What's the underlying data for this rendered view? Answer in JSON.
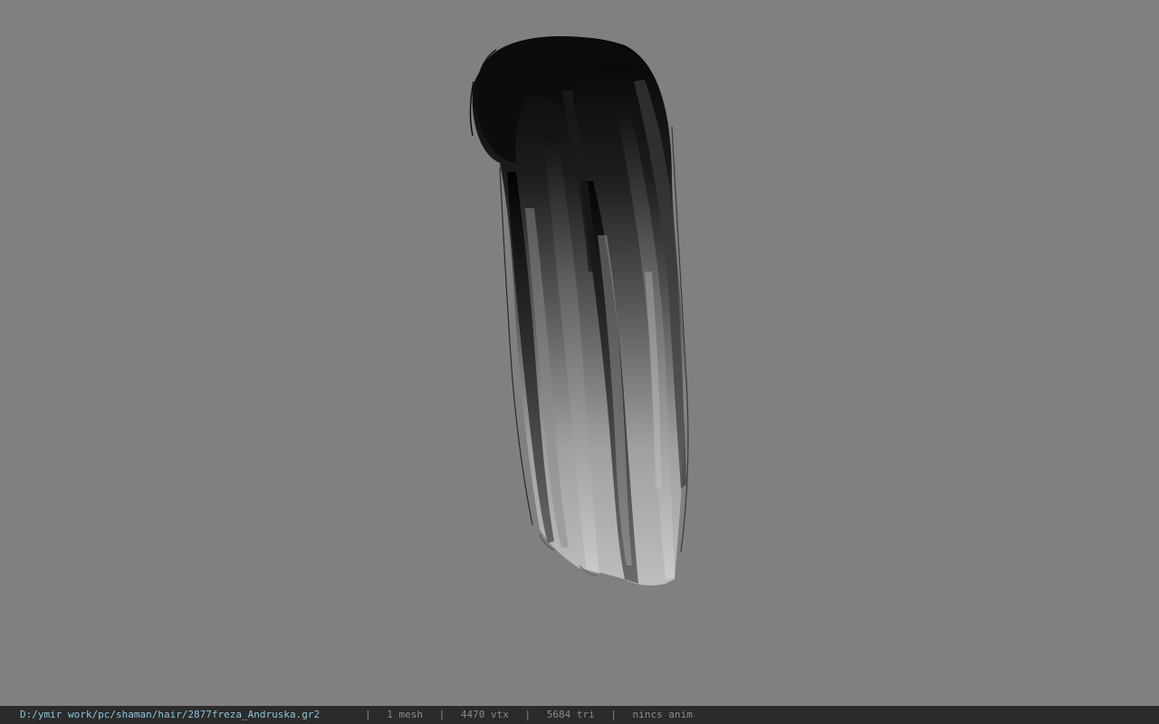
{
  "viewport": {
    "background_color": "#808080",
    "model_name": "hair-mesh"
  },
  "status": {
    "file_path": "D:/ymir work/pc/shaman/hair/2877freza_Andruska.gr2",
    "separator": "|",
    "mesh_count": "1 mesh",
    "vertex_count": "4470 vtx",
    "triangle_count": "5684 tri",
    "anim_status": "nincs anim"
  },
  "colors": {
    "statusbar_bg": "#2b2b2b",
    "path_text": "#8fc3dc",
    "stats_text": "#8a8a8a",
    "hair_dark": "#0a0a0a",
    "hair_light": "#b8b8b8"
  }
}
